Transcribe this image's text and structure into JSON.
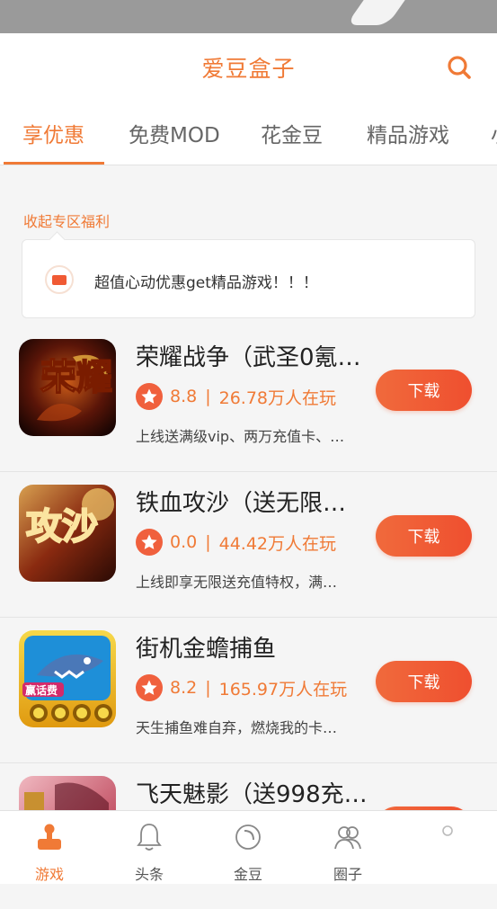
{
  "header": {
    "title": "爱豆盒子"
  },
  "tabs": [
    {
      "label": "享优惠"
    },
    {
      "label": "免费MOD"
    },
    {
      "label": "花金豆"
    },
    {
      "label": "精品游戏"
    },
    {
      "label": "小"
    }
  ],
  "zone": {
    "collapse_label": "收起专区福利",
    "notice_text": "超值心动优惠get精品游戏！！！"
  },
  "games": [
    {
      "name": "荣耀战争（武圣0氪…",
      "rating": "8.8",
      "players": "26.78万人在玩",
      "desc": "上线送满级vip、两万充值卡、…",
      "button": "下载",
      "icon": "rongyao-game-icon"
    },
    {
      "name": "铁血攻沙（送无限…",
      "rating": "0.0",
      "players": "44.42万人在玩",
      "desc": "上线即享无限送充值特权，满…",
      "button": "下载",
      "icon": "gongsha-game-icon"
    },
    {
      "name": "街机金蟾捕鱼",
      "rating": "8.2",
      "players": "165.97万人在玩",
      "desc": "天生捕鱼难自弃，燃烧我的卡…",
      "button": "下载",
      "icon": "fishing-game-icon"
    },
    {
      "name": "飞天魅影（送998充…",
      "rating": "",
      "players": "",
      "desc": "",
      "button": "",
      "icon": "feitian-game-icon"
    }
  ],
  "thumb_text": {
    "g1": "荣耀",
    "g2": "攻沙",
    "g3": "赢话费"
  },
  "bottom_nav": [
    {
      "label": "游戏",
      "icon": "game-controller-icon"
    },
    {
      "label": "头条",
      "icon": "bell-icon"
    },
    {
      "label": "金豆",
      "icon": "coin-icon"
    },
    {
      "label": "圈子",
      "icon": "group-icon"
    },
    {
      "label": "",
      "icon": "user-icon"
    }
  ],
  "colors": {
    "accent": "#f07a36",
    "button": "#ef5a34"
  }
}
